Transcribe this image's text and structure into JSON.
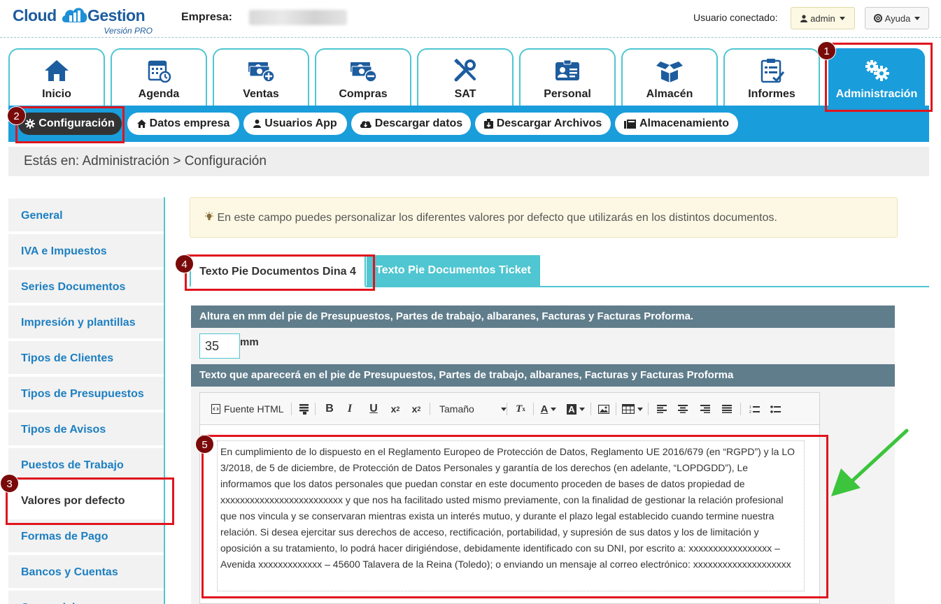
{
  "header": {
    "logo_cloud": "Cloud",
    "logo_gestion": "Gestion",
    "logo_version": "Versión PRO",
    "empresa_label": "Empresa:",
    "user_label": "Usuario conectado:",
    "user_button": "admin",
    "help_button": "Ayuda"
  },
  "modules": [
    {
      "label": "Inicio",
      "icon": "home-icon"
    },
    {
      "label": "Agenda",
      "icon": "calendar-icon"
    },
    {
      "label": "Ventas",
      "icon": "money-plus-icon"
    },
    {
      "label": "Compras",
      "icon": "money-minus-icon"
    },
    {
      "label": "SAT",
      "icon": "tools-icon"
    },
    {
      "label": "Personal",
      "icon": "id-card-icon"
    },
    {
      "label": "Almacén",
      "icon": "boxes-icon"
    },
    {
      "label": "Informes",
      "icon": "clipboard-icon"
    },
    {
      "label": "Administración",
      "icon": "gears-icon"
    }
  ],
  "subnav": [
    {
      "label": "Configuración",
      "icon": "gear-icon"
    },
    {
      "label": "Datos empresa",
      "icon": "home-icon"
    },
    {
      "label": "Usuarios App",
      "icon": "user-icon"
    },
    {
      "label": "Descargar datos",
      "icon": "cloud-download-icon"
    },
    {
      "label": "Descargar Archivos",
      "icon": "file-download-icon"
    },
    {
      "label": "Almacenamiento",
      "icon": "folder-icon"
    }
  ],
  "breadcrumb": "Estás en: Administración > Configuración",
  "sidebar": [
    "General",
    "IVA e Impuestos",
    "Series Documentos",
    "Impresión y plantillas",
    "Tipos de Clientes",
    "Tipos de Presupuestos",
    "Tipos de Avisos",
    "Puestos de Trabajo",
    "Valores por defecto",
    "Formas de Pago",
    "Bancos y Cuentas",
    "Comercial"
  ],
  "info_text": "En este campo puedes personalizar los diferentes valores por defecto que utilizarás en los distintos documentos.",
  "tabs": {
    "dina4": "Texto Pie Documentos Dina 4",
    "ticket": "Texto Pie Documentos Ticket"
  },
  "panel": {
    "height_header": "Altura en mm del pie de Presupuestos, Partes de trabajo, albaranes, Facturas y Facturas Proforma.",
    "height_value": "35",
    "height_unit": "mm",
    "text_header": "Texto que aparecerá en el pie de Presupuestos, Partes de trabajo, albaranes, Facturas y Facturas Proforma"
  },
  "editor": {
    "source_button": "Fuente HTML",
    "size_select": "Tamaño",
    "content": "En cumplimiento de lo dispuesto en el Reglamento Europeo de Protección de Datos, Reglamento UE 2016/679 (en “RGPD”) y la LO 3/2018, de 5 de diciembre, de Protección de Datos Personales y garantía de los derechos (en adelante, “LOPDGDD”), Le informamos que los datos personales que puedan constar en este documento proceden de bases de datos propiedad de xxxxxxxxxxxxxxxxxxxxxxxxx y que nos ha facilitado usted mismo previamente, con la finalidad de gestionar la relación profesional que nos vincula y se conservaran mientras exista un interés mutuo, y durante el plazo legal establecido cuando termine nuestra relación. Si desea ejercitar sus derechos de acceso, rectificación, portabilidad, y supresión de sus datos y los de limitación y oposición a su tratamiento, lo podrá hacer dirigiéndose, debidamente identificado con su DNI, por escrito a: xxxxxxxxxxxxxxxxx – Avenida xxxxxxxxxxxxx – 45600 Talavera de la Reina (Toledo); o enviando un mensaje al correo electrónico: xxxxxxxxxxxxxxxxxxxx"
  },
  "annotations": [
    "1",
    "2",
    "3",
    "4",
    "5"
  ],
  "colors": {
    "accent": "#1a9ddb",
    "tab_border": "#4fc6d1",
    "panel_header": "#607d8b",
    "annotation": "#e0141e",
    "arrow": "#3cc43c"
  }
}
